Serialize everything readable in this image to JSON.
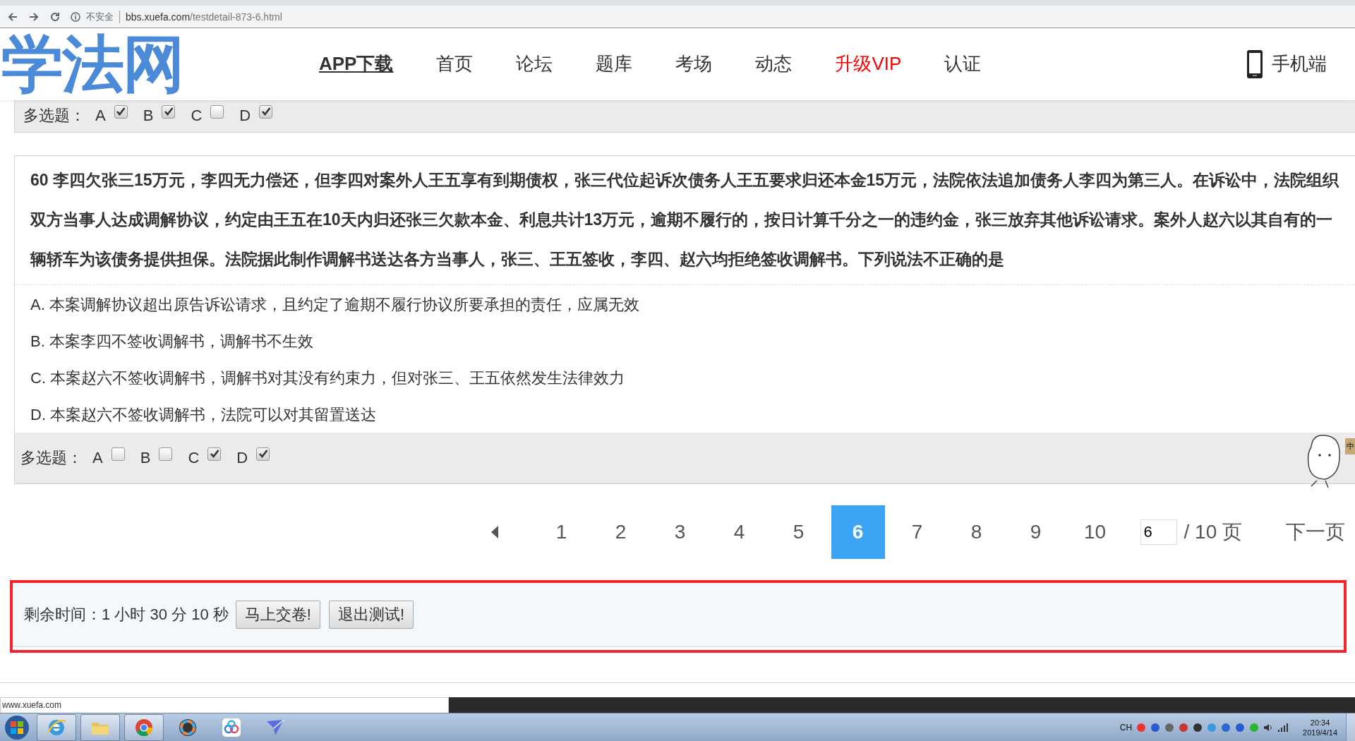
{
  "browser": {
    "security_label": "不安全",
    "url_host": "bbs.xuefa.com",
    "url_path": "/testdetail-873-6.html"
  },
  "site_header": {
    "logo": "学法网",
    "nav": [
      {
        "label": "APP下载",
        "kind": "download"
      },
      {
        "label": "首页",
        "kind": "link"
      },
      {
        "label": "论坛",
        "kind": "link"
      },
      {
        "label": "题库",
        "kind": "link"
      },
      {
        "label": "考场",
        "kind": "link"
      },
      {
        "label": "动态",
        "kind": "link"
      },
      {
        "label": "升级VIP",
        "kind": "vip"
      },
      {
        "label": "认证",
        "kind": "link"
      }
    ],
    "mobile_link": "手机端"
  },
  "previous_answer": {
    "label": "多选题：",
    "options": [
      {
        "letter": "A",
        "checked": true
      },
      {
        "letter": "B",
        "checked": true
      },
      {
        "letter": "C",
        "checked": false
      },
      {
        "letter": "D",
        "checked": true
      }
    ]
  },
  "question": {
    "text": "60 李四欠张三15万元，李四无力偿还，但李四对案外人王五享有到期债权，张三代位起诉次债务人王五要求归还本金15万元，法院依法追加债务人李四为第三人。在诉讼中，法院组织双方当事人达成调解协议，约定由王五在10天内归还张三欠款本金、利息共计13万元，逾期不履行的，按日计算千分之一的违约金，张三放弃其他诉讼请求。案外人赵六以其自有的一辆轿车为该债务提供担保。法院据此制作调解书送达各方当事人，张三、王五签收，李四、赵六均拒绝签收调解书。下列说法不正确的是",
    "options": [
      "A. 本案调解协议超出原告诉讼请求，且约定了逾期不履行协议所要承担的责任，应属无效",
      "B. 本案李四不签收调解书，调解书不生效",
      "C. 本案赵六不签收调解书，调解书对其没有约束力，但对张三、王五依然发生法律效力",
      "D. 本案赵六不签收调解书，法院可以对其留置送达"
    ],
    "answer": {
      "label": "多选题：",
      "options": [
        {
          "letter": "A",
          "checked": false
        },
        {
          "letter": "B",
          "checked": false
        },
        {
          "letter": "C",
          "checked": true
        },
        {
          "letter": "D",
          "checked": true
        }
      ]
    }
  },
  "side_widget": {
    "label": "中"
  },
  "pagination": {
    "pages": [
      {
        "label": "1",
        "selected": false
      },
      {
        "label": "2",
        "selected": false
      },
      {
        "label": "3",
        "selected": false
      },
      {
        "label": "4",
        "selected": false
      },
      {
        "label": "5",
        "selected": false
      },
      {
        "label": "6",
        "selected": true
      },
      {
        "label": "7",
        "selected": false
      },
      {
        "label": "8",
        "selected": false
      },
      {
        "label": "9",
        "selected": false
      },
      {
        "label": "10",
        "selected": false
      }
    ],
    "page_input": "6",
    "total": "/ 10 页",
    "next": "下一页"
  },
  "timer": {
    "label": "剩余时间：1 小时 30 分 10 秒",
    "buttons": [
      "马上交卷!",
      "退出测试!"
    ]
  },
  "status_url": "www.xuefa.com",
  "taskbar": {
    "apps": [
      {
        "kind": "ie",
        "running": true
      },
      {
        "kind": "folder",
        "running": true
      },
      {
        "kind": "chrome",
        "running": true
      },
      {
        "kind": "colorwheel",
        "running": false
      },
      {
        "kind": "cloud",
        "running": false
      },
      {
        "kind": "bird",
        "running": false
      }
    ],
    "input_lang": "CH",
    "time": "20:34",
    "date": "2019/4/14"
  }
}
